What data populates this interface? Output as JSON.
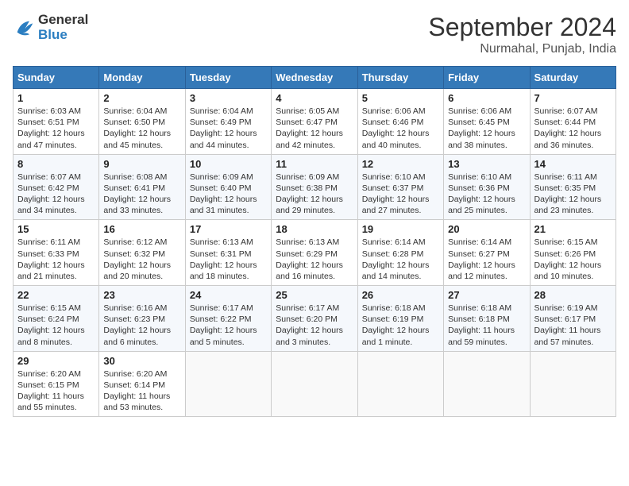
{
  "header": {
    "logo_general": "General",
    "logo_blue": "Blue",
    "month_title": "September 2024",
    "location": "Nurmahal, Punjab, India"
  },
  "days_of_week": [
    "Sunday",
    "Monday",
    "Tuesday",
    "Wednesday",
    "Thursday",
    "Friday",
    "Saturday"
  ],
  "weeks": [
    [
      {
        "day": 1,
        "lines": [
          "Sunrise: 6:03 AM",
          "Sunset: 6:51 PM",
          "Daylight: 12 hours",
          "and 47 minutes."
        ]
      },
      {
        "day": 2,
        "lines": [
          "Sunrise: 6:04 AM",
          "Sunset: 6:50 PM",
          "Daylight: 12 hours",
          "and 45 minutes."
        ]
      },
      {
        "day": 3,
        "lines": [
          "Sunrise: 6:04 AM",
          "Sunset: 6:49 PM",
          "Daylight: 12 hours",
          "and 44 minutes."
        ]
      },
      {
        "day": 4,
        "lines": [
          "Sunrise: 6:05 AM",
          "Sunset: 6:47 PM",
          "Daylight: 12 hours",
          "and 42 minutes."
        ]
      },
      {
        "day": 5,
        "lines": [
          "Sunrise: 6:06 AM",
          "Sunset: 6:46 PM",
          "Daylight: 12 hours",
          "and 40 minutes."
        ]
      },
      {
        "day": 6,
        "lines": [
          "Sunrise: 6:06 AM",
          "Sunset: 6:45 PM",
          "Daylight: 12 hours",
          "and 38 minutes."
        ]
      },
      {
        "day": 7,
        "lines": [
          "Sunrise: 6:07 AM",
          "Sunset: 6:44 PM",
          "Daylight: 12 hours",
          "and 36 minutes."
        ]
      }
    ],
    [
      {
        "day": 8,
        "lines": [
          "Sunrise: 6:07 AM",
          "Sunset: 6:42 PM",
          "Daylight: 12 hours",
          "and 34 minutes."
        ]
      },
      {
        "day": 9,
        "lines": [
          "Sunrise: 6:08 AM",
          "Sunset: 6:41 PM",
          "Daylight: 12 hours",
          "and 33 minutes."
        ]
      },
      {
        "day": 10,
        "lines": [
          "Sunrise: 6:09 AM",
          "Sunset: 6:40 PM",
          "Daylight: 12 hours",
          "and 31 minutes."
        ]
      },
      {
        "day": 11,
        "lines": [
          "Sunrise: 6:09 AM",
          "Sunset: 6:38 PM",
          "Daylight: 12 hours",
          "and 29 minutes."
        ]
      },
      {
        "day": 12,
        "lines": [
          "Sunrise: 6:10 AM",
          "Sunset: 6:37 PM",
          "Daylight: 12 hours",
          "and 27 minutes."
        ]
      },
      {
        "day": 13,
        "lines": [
          "Sunrise: 6:10 AM",
          "Sunset: 6:36 PM",
          "Daylight: 12 hours",
          "and 25 minutes."
        ]
      },
      {
        "day": 14,
        "lines": [
          "Sunrise: 6:11 AM",
          "Sunset: 6:35 PM",
          "Daylight: 12 hours",
          "and 23 minutes."
        ]
      }
    ],
    [
      {
        "day": 15,
        "lines": [
          "Sunrise: 6:11 AM",
          "Sunset: 6:33 PM",
          "Daylight: 12 hours",
          "and 21 minutes."
        ]
      },
      {
        "day": 16,
        "lines": [
          "Sunrise: 6:12 AM",
          "Sunset: 6:32 PM",
          "Daylight: 12 hours",
          "and 20 minutes."
        ]
      },
      {
        "day": 17,
        "lines": [
          "Sunrise: 6:13 AM",
          "Sunset: 6:31 PM",
          "Daylight: 12 hours",
          "and 18 minutes."
        ]
      },
      {
        "day": 18,
        "lines": [
          "Sunrise: 6:13 AM",
          "Sunset: 6:29 PM",
          "Daylight: 12 hours",
          "and 16 minutes."
        ]
      },
      {
        "day": 19,
        "lines": [
          "Sunrise: 6:14 AM",
          "Sunset: 6:28 PM",
          "Daylight: 12 hours",
          "and 14 minutes."
        ]
      },
      {
        "day": 20,
        "lines": [
          "Sunrise: 6:14 AM",
          "Sunset: 6:27 PM",
          "Daylight: 12 hours",
          "and 12 minutes."
        ]
      },
      {
        "day": 21,
        "lines": [
          "Sunrise: 6:15 AM",
          "Sunset: 6:26 PM",
          "Daylight: 12 hours",
          "and 10 minutes."
        ]
      }
    ],
    [
      {
        "day": 22,
        "lines": [
          "Sunrise: 6:15 AM",
          "Sunset: 6:24 PM",
          "Daylight: 12 hours",
          "and 8 minutes."
        ]
      },
      {
        "day": 23,
        "lines": [
          "Sunrise: 6:16 AM",
          "Sunset: 6:23 PM",
          "Daylight: 12 hours",
          "and 6 minutes."
        ]
      },
      {
        "day": 24,
        "lines": [
          "Sunrise: 6:17 AM",
          "Sunset: 6:22 PM",
          "Daylight: 12 hours",
          "and 5 minutes."
        ]
      },
      {
        "day": 25,
        "lines": [
          "Sunrise: 6:17 AM",
          "Sunset: 6:20 PM",
          "Daylight: 12 hours",
          "and 3 minutes."
        ]
      },
      {
        "day": 26,
        "lines": [
          "Sunrise: 6:18 AM",
          "Sunset: 6:19 PM",
          "Daylight: 12 hours",
          "and 1 minute."
        ]
      },
      {
        "day": 27,
        "lines": [
          "Sunrise: 6:18 AM",
          "Sunset: 6:18 PM",
          "Daylight: 11 hours",
          "and 59 minutes."
        ]
      },
      {
        "day": 28,
        "lines": [
          "Sunrise: 6:19 AM",
          "Sunset: 6:17 PM",
          "Daylight: 11 hours",
          "and 57 minutes."
        ]
      }
    ],
    [
      {
        "day": 29,
        "lines": [
          "Sunrise: 6:20 AM",
          "Sunset: 6:15 PM",
          "Daylight: 11 hours",
          "and 55 minutes."
        ]
      },
      {
        "day": 30,
        "lines": [
          "Sunrise: 6:20 AM",
          "Sunset: 6:14 PM",
          "Daylight: 11 hours",
          "and 53 minutes."
        ]
      },
      null,
      null,
      null,
      null,
      null
    ]
  ]
}
